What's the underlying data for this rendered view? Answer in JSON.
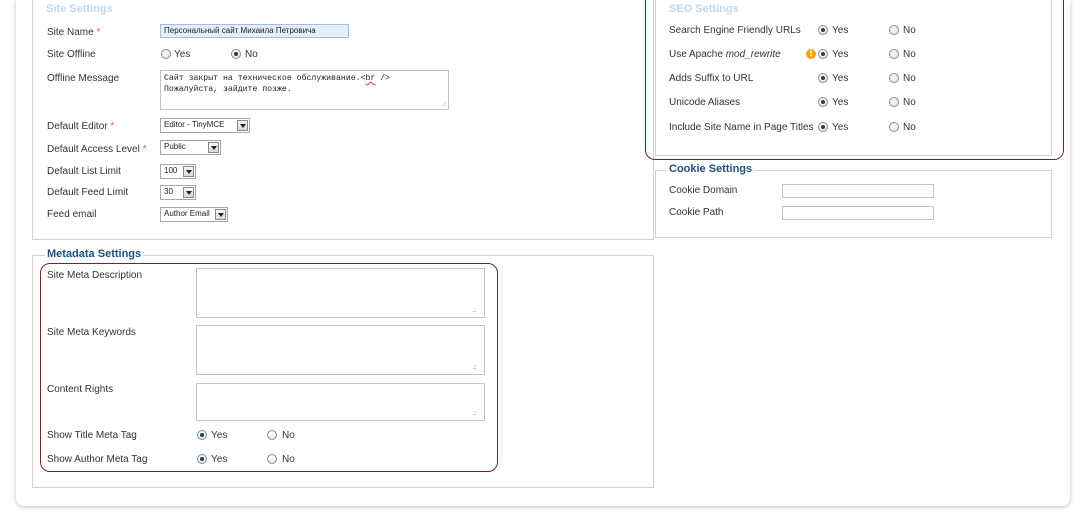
{
  "site_settings": {
    "legend": "Site Settings",
    "site_name": {
      "label": "Site Name",
      "required": "*",
      "value": "Персональный сайт Михаила Петровича"
    },
    "site_offline": {
      "label": "Site Offline",
      "yes": "Yes",
      "no": "No",
      "selected": "No"
    },
    "offline_message": {
      "label": "Offline Message",
      "line1_prefix": "Сайт закрыт на техническое обслуживание.<",
      "line1_spell": "br",
      "line1_suffix": " />",
      "line2": "Пожалуйста, зайдите позже."
    },
    "default_editor": {
      "label": "Default Editor",
      "required": "*",
      "value": "Editor - TinyMCE"
    },
    "default_access_level": {
      "label": "Default Access Level",
      "required": "*",
      "value": "Public"
    },
    "default_list_limit": {
      "label": "Default List Limit",
      "value": "100"
    },
    "default_feed_limit": {
      "label": "Default Feed Limit",
      "value": "30"
    },
    "feed_email": {
      "label": "Feed email",
      "value": "Author Email"
    }
  },
  "metadata_settings": {
    "legend": "Metadata Settings",
    "site_meta_description": {
      "label": "Site Meta Description",
      "value": ""
    },
    "site_meta_keywords": {
      "label": "Site Meta Keywords",
      "value": ""
    },
    "content_rights": {
      "label": "Content Rights",
      "value": ""
    },
    "show_title_meta_tag": {
      "label": "Show Title Meta Tag",
      "yes": "Yes",
      "no": "No",
      "selected": "Yes"
    },
    "show_author_meta_tag": {
      "label": "Show Author Meta Tag",
      "yes": "Yes",
      "no": "No",
      "selected": "Yes"
    }
  },
  "seo_settings": {
    "legend": "SEO Settings",
    "sef_urls": {
      "label": "Search Engine Friendly URLs",
      "yes": "Yes",
      "no": "No",
      "selected": "Yes"
    },
    "mod_rewrite": {
      "label_prefix": "Use Apache ",
      "label_em": "mod_rewrite",
      "yes": "Yes",
      "no": "No",
      "selected": "Yes",
      "warning_icon": "!"
    },
    "adds_suffix": {
      "label": "Adds Suffix to URL",
      "yes": "Yes",
      "no": "No",
      "selected": "Yes"
    },
    "unicode_aliases": {
      "label": "Unicode Aliases",
      "yes": "Yes",
      "no": "No",
      "selected": "Yes"
    },
    "include_site_name": {
      "label": "Include Site Name in Page Titles",
      "yes": "Yes",
      "no": "No",
      "selected": "Yes"
    }
  },
  "cookie_settings": {
    "legend": "Cookie Settings",
    "cookie_domain": {
      "label": "Cookie Domain",
      "value": ""
    },
    "cookie_path": {
      "label": "Cookie Path",
      "value": ""
    }
  },
  "colors": {
    "legend": "#1f4f7d",
    "highlight_border": "#7a1f2b",
    "required": "#e55",
    "warning": "#f0a500"
  },
  "icons": {
    "warning": "warning-icon",
    "resize_grip": "resize-grip-icon",
    "dropdown": "chevron-down-icon"
  }
}
